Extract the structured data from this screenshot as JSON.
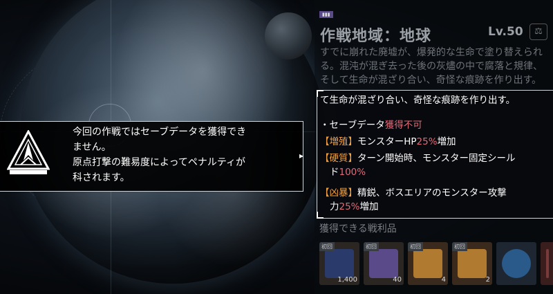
{
  "region": {
    "badge": "",
    "title": "作戦地域：地球",
    "level": "Lv.50",
    "description": "すでに崩れた廃墟が、爆発的な生命で塗り替えられる。混沌が混ぎ去った後の灰燼の中で腐落と規律、そして生命が混ざり合い、奇怪な痕跡を作り出す。"
  },
  "warning": {
    "line1": "今回の作戦ではセーブデータを獲得でき",
    "line2": "ません。",
    "line3": "原点打撃の難易度によってペナルティが",
    "line4": "科されます。"
  },
  "info": {
    "lead": "て生命が混ざり合い、奇怪な痕跡を作り出す。",
    "save_label": "・セーブデータ",
    "save_value": "獲得不可",
    "row1_tag": "【増殖】",
    "row1_text": "モンスターHP",
    "row1_pct": "25%",
    "row1_suffix": "増加",
    "row2_tag": "【硬質】",
    "row2_text": "ターン開始時、モンスター固定シール",
    "row2_text2": "ド",
    "row2_pct": "100%",
    "row3_tag": "【凶暴】",
    "row3_text": "精鋭、ボスエリアのモンスター攻撃",
    "row3_text2": "力",
    "row3_pct": "25%",
    "row3_suffix": "増加"
  },
  "loot": {
    "title": "獲得できる戦利品",
    "items": [
      {
        "tag": "初回",
        "count": "1,400",
        "color": "#2a3a6a"
      },
      {
        "tag": "初回",
        "count": "40",
        "color": "#5a4a8a"
      },
      {
        "tag": "初回",
        "count": "4",
        "color": "#b07a30"
      },
      {
        "tag": "初回",
        "count": "2",
        "color": "#b07a30"
      },
      {
        "tag": "",
        "count": "",
        "color": "#2a5a8a"
      },
      {
        "tag": "",
        "count": "",
        "color": "#7a3a3a"
      }
    ]
  },
  "colors": {
    "accent_red": "#e06a78",
    "accent_orange": "#f0a040"
  }
}
